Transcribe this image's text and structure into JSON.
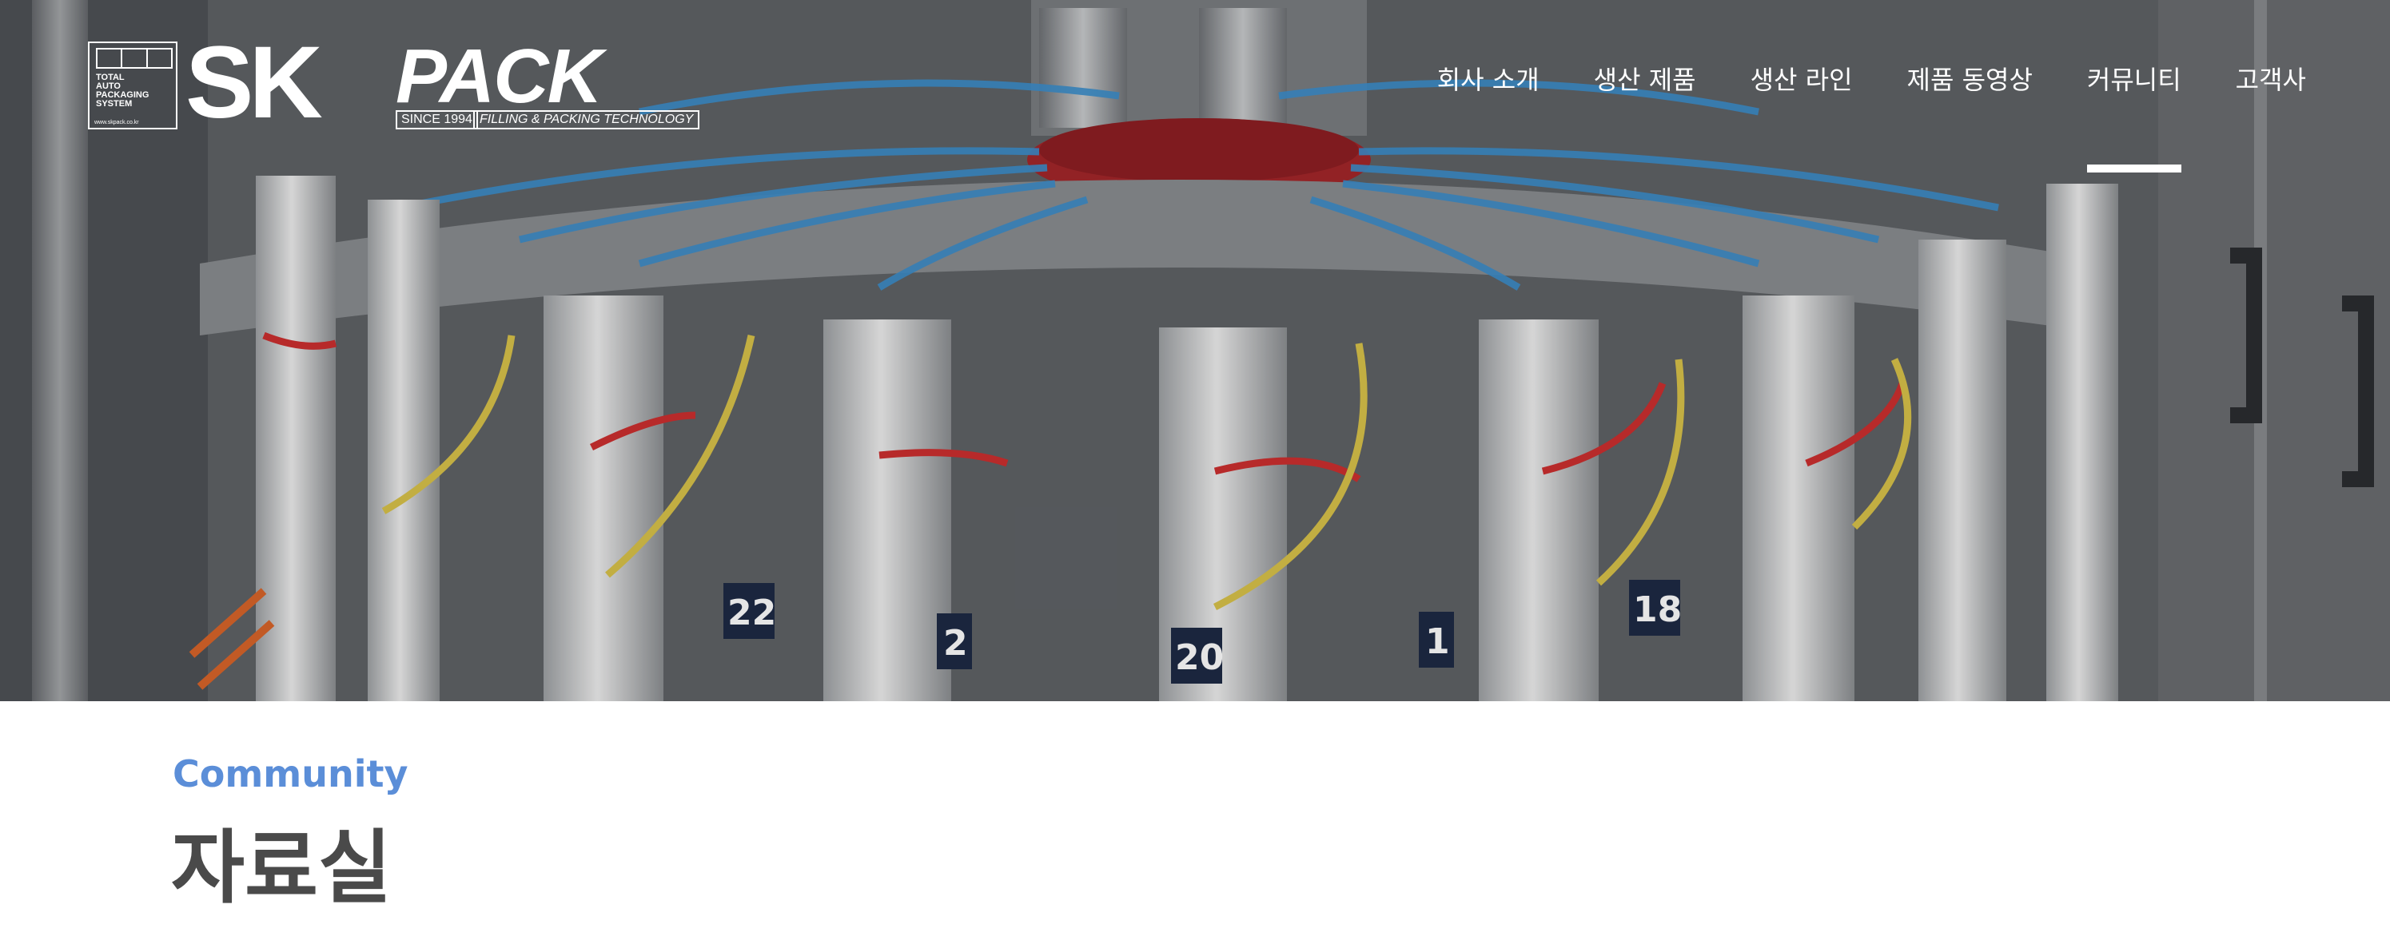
{
  "logo": {
    "badge_lines": "TOTAL\nAUTO\nPACKAGING\nSYSTEM",
    "badge_url": "www.skpack.co.kr",
    "brand_sk": "SK",
    "brand_pack": "PACK",
    "since": "SINCE 1994",
    "tagline": "FILLING & PACKING TECHNOLOGY"
  },
  "nav": {
    "items": [
      {
        "label": "회사 소개"
      },
      {
        "label": "생산 제품"
      },
      {
        "label": "생산 라인"
      },
      {
        "label": "제품 동영상"
      },
      {
        "label": "커뮤니티",
        "active": true
      },
      {
        "label": "고객사"
      }
    ]
  },
  "hero": {
    "image": "filling-machine-photo",
    "station_numbers": [
      "22",
      "2",
      "20",
      "1",
      "18"
    ]
  },
  "section": {
    "eyebrow": "Community",
    "title": "자료실"
  },
  "colors": {
    "accent": "#5b8ed8",
    "title": "#4a4a4a",
    "nav_text": "#ffffff"
  }
}
